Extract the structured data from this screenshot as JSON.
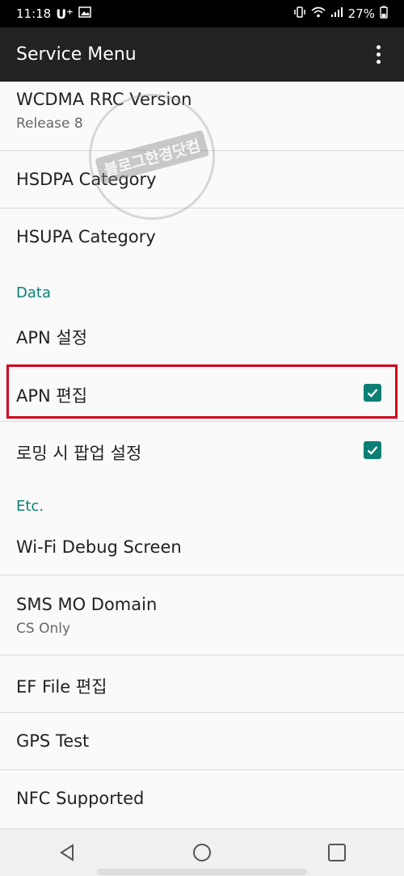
{
  "status_bar": {
    "time": "11:18",
    "carrier": "U⁺",
    "battery": "27%"
  },
  "app_bar": {
    "title": "Service Menu"
  },
  "list": {
    "wcdma": {
      "title": "WCDMA RRC Version",
      "subtitle": "Release 8"
    },
    "hsdpa": {
      "title": "HSDPA Category"
    },
    "hsupa": {
      "title": "HSUPA Category"
    },
    "section_data": "Data",
    "apn_settings": {
      "title": "APN 설정"
    },
    "apn_edit": {
      "title": "APN 편집",
      "checked": true
    },
    "roaming_popup": {
      "title": "로밍 시 팝업 설정",
      "checked": true
    },
    "section_etc": "Etc.",
    "wifi_debug": {
      "title": "Wi-Fi Debug Screen"
    },
    "sms_mo": {
      "title": "SMS MO Domain",
      "subtitle": "CS Only"
    },
    "ef_file": {
      "title": "EF File 편집"
    },
    "gps_test": {
      "title": "GPS Test"
    },
    "nfc": {
      "title": "NFC Supported"
    }
  },
  "watermark": {
    "text": "블로그한경닷컴"
  },
  "colors": {
    "accent": "#0b7f74",
    "highlight": "#d0021b",
    "app_bar": "#222222"
  }
}
